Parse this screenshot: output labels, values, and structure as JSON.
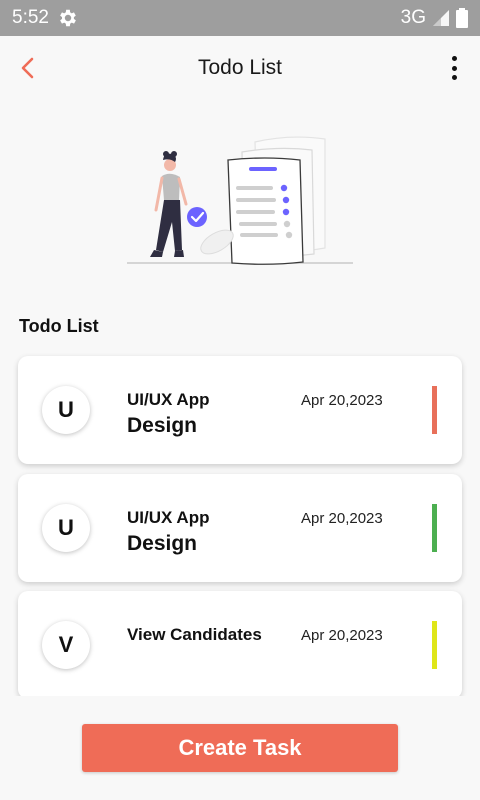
{
  "status_bar": {
    "time": "5:52",
    "network": "3G"
  },
  "app_bar": {
    "title": "Todo List",
    "accent_color": "#ef6c57"
  },
  "section_title": "Todo List",
  "tasks": [
    {
      "avatar_letter": "U",
      "title": "UI/UX App",
      "subtitle": "Design",
      "date": "Apr 20,2023",
      "priority_color": "#e8705a"
    },
    {
      "avatar_letter": "U",
      "title": "UI/UX App",
      "subtitle": "Design",
      "date": "Apr 20,2023",
      "priority_color": "#4caf50"
    },
    {
      "avatar_letter": "V",
      "title": "View Candidates",
      "subtitle": "",
      "date": "Apr 20,2023",
      "priority_color": "#dfe619"
    }
  ],
  "create_button": {
    "label": "Create Task",
    "color": "#ef6c57"
  }
}
